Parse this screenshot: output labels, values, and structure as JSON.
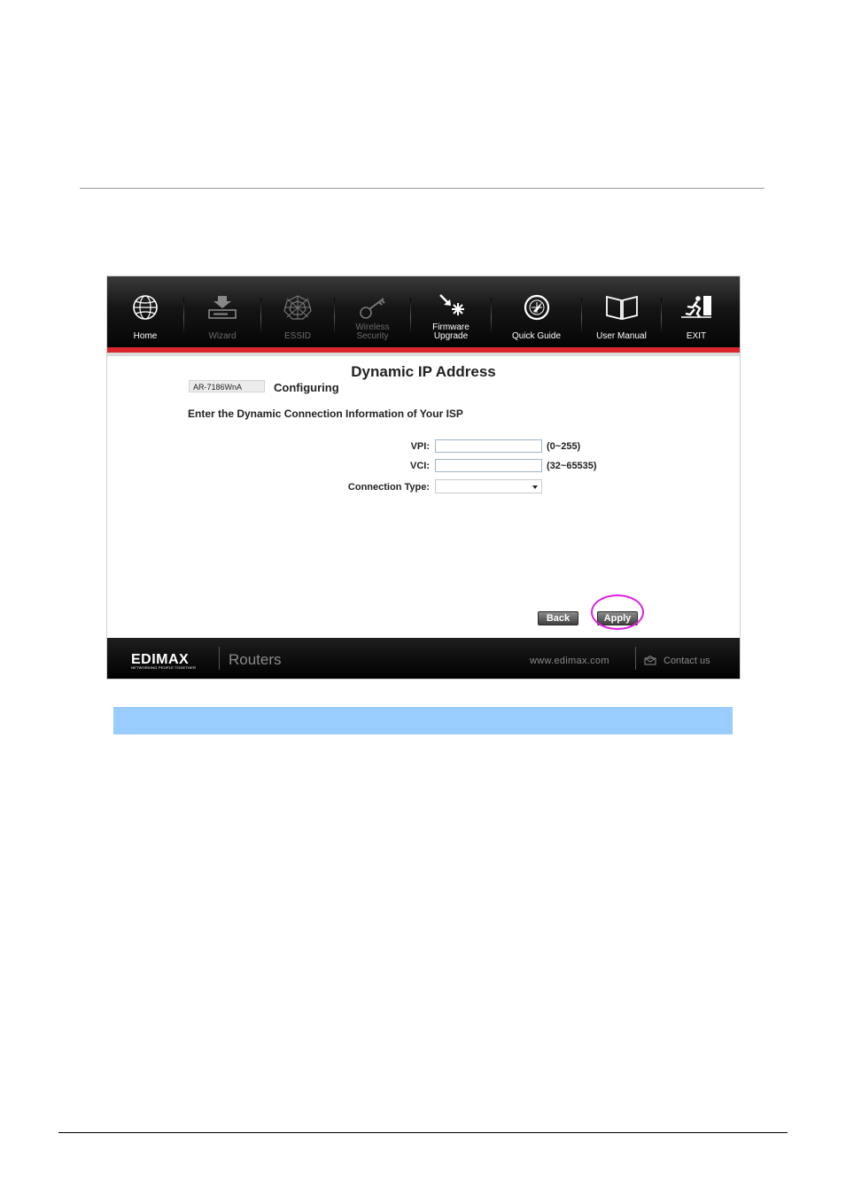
{
  "nav": {
    "items": [
      {
        "label": "Home",
        "icon": "globe-icon",
        "dim": false
      },
      {
        "label": "Wizard",
        "icon": "download-icon",
        "dim": true
      },
      {
        "label": "ESSID",
        "icon": "spider-web-icon",
        "dim": true
      },
      {
        "label": "Wireless Security",
        "label1": "Wireless",
        "label2": "Security",
        "icon": "key-icon",
        "dim": true
      },
      {
        "label": "Firmware Upgrade",
        "label1": "Firmware",
        "label2": "Upgrade",
        "icon": "firmware-icon",
        "dim": false
      },
      {
        "label": "Quick Guide",
        "icon": "compass-icon",
        "dim": false
      },
      {
        "label": "User Manual",
        "icon": "book-icon",
        "dim": false
      },
      {
        "label": "EXIT",
        "icon": "exit-icon",
        "dim": false
      }
    ]
  },
  "page": {
    "title": "Dynamic IP Address",
    "model": "AR-7186WnA",
    "status": "Configuring",
    "instruction": "Enter the Dynamic Connection Information of Your ISP"
  },
  "form": {
    "vpi_label": "VPI:",
    "vpi_value": "",
    "vpi_range": "(0~255)",
    "vci_label": "VCI:",
    "vci_value": "",
    "vci_range": "(32~65535)",
    "conn_type_label": "Connection Type:",
    "conn_type_value": ""
  },
  "buttons": {
    "back": "Back",
    "apply": "Apply"
  },
  "footer": {
    "logo": "EDIMAX",
    "logo_tagline": "NETWORKING PEOPLE TOGETHER",
    "product": "Routers",
    "website": "www.edimax.com",
    "contact": "Contact us"
  },
  "colors": {
    "accent_red": "#d9262f",
    "highlight_magenta": "#e020e0",
    "note_bar": "#99ccff"
  }
}
